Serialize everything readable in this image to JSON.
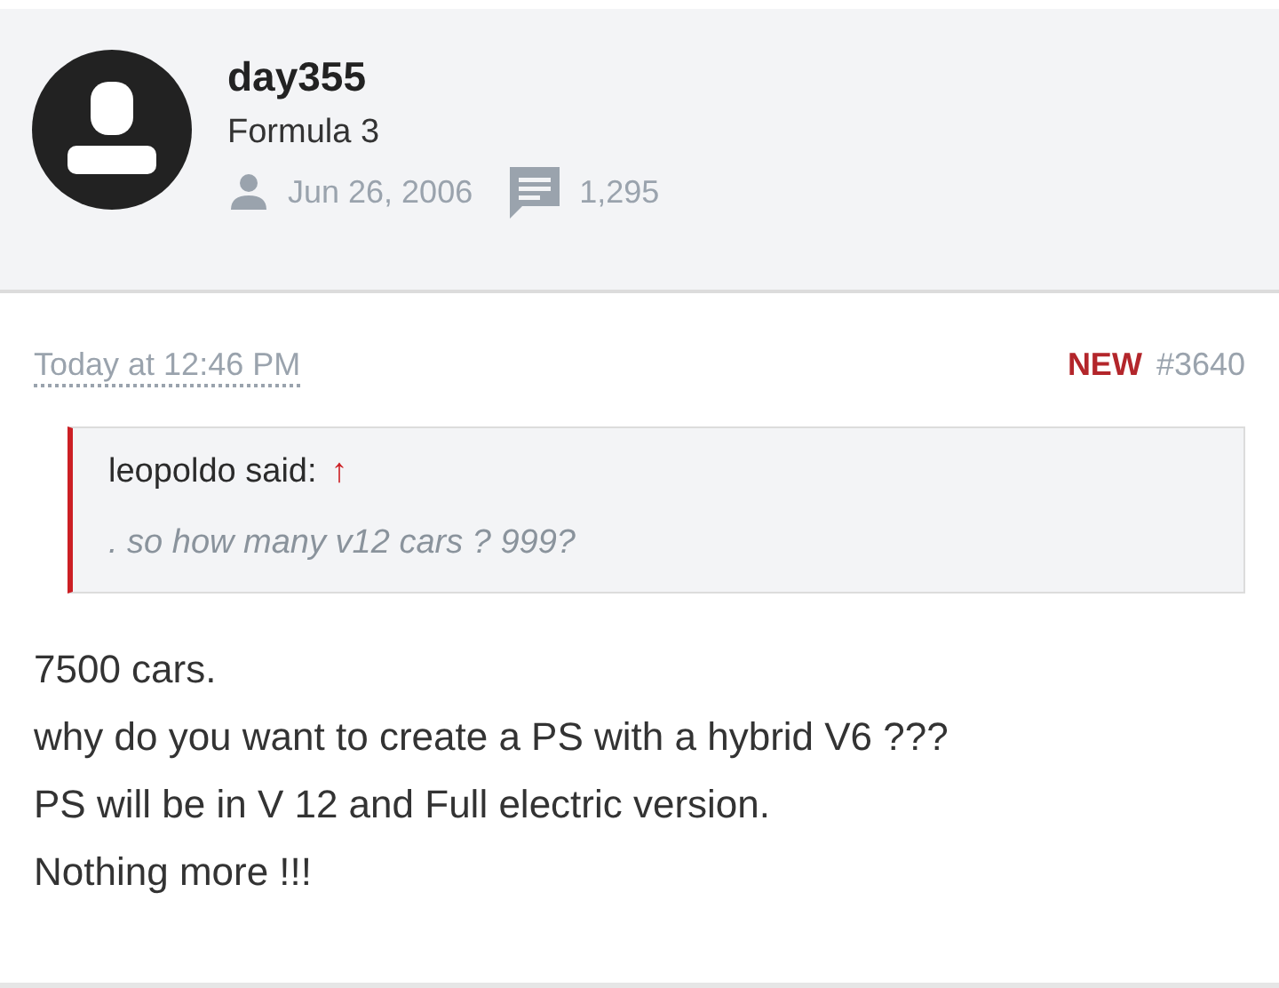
{
  "author": {
    "username": "day355",
    "title": "Formula 3",
    "joined": "Jun 26, 2006",
    "messages": "1,295"
  },
  "post": {
    "time": "Today at 12:46 PM",
    "badge": "NEW",
    "number": "#3640",
    "quote": {
      "author": "leopoldo said:",
      "link": "↑",
      "text": ". so how many v12 cars ? 999?"
    },
    "lines": [
      "7500 cars.",
      "why do you want to create a PS with a hybrid V6 ???",
      "PS will be in V 12 and Full electric version.",
      "Nothing more !!!"
    ]
  }
}
